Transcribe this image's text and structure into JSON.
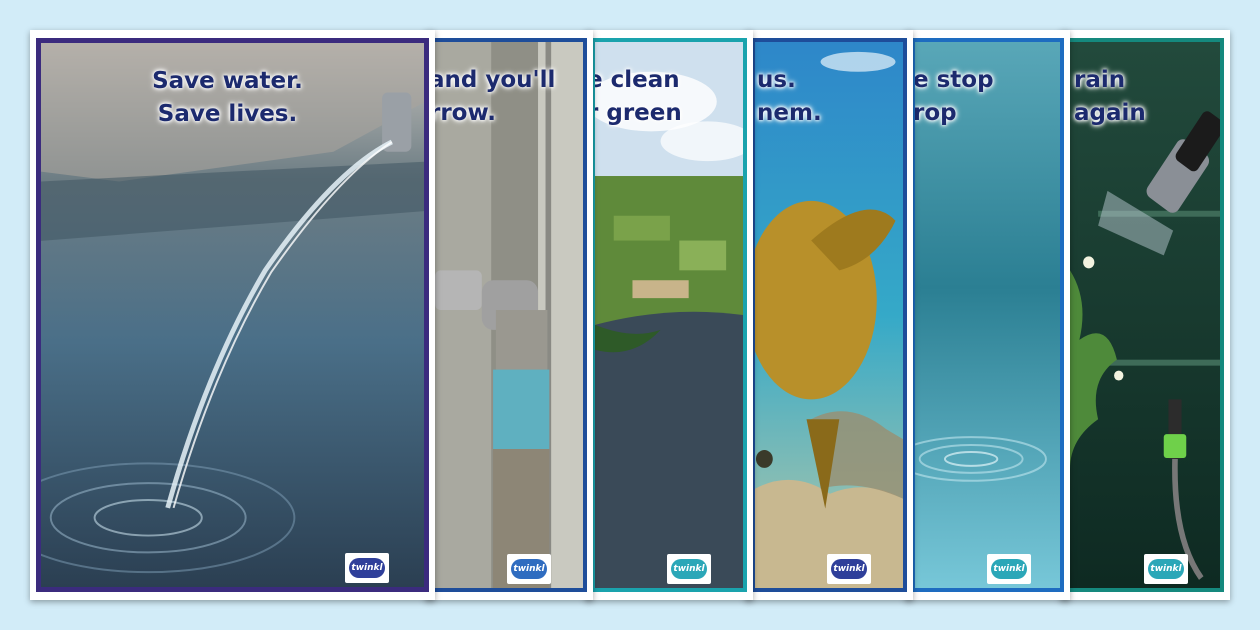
{
  "brand": "twinkl",
  "posters": [
    {
      "headline_lines": [
        "Save water.",
        "Save lives."
      ],
      "border_color": "#3b2b7e"
    },
    {
      "headline_lines": [
        "and you'll",
        "rrow."
      ],
      "border_color": "#1e4d9a"
    },
    {
      "headline_lines": [
        "e clean",
        "r green"
      ],
      "border_color": "#1aa3ad"
    },
    {
      "headline_lines": [
        "us.",
        "nem."
      ],
      "border_color": "#1e4d9a"
    },
    {
      "headline_lines": [
        "e stop",
        "rop"
      ],
      "border_color": "#1e6cc0"
    },
    {
      "headline_lines": [
        "rain",
        "again"
      ],
      "border_color": "#15897e"
    }
  ],
  "colors": {
    "headline_text": "#1c2a6e",
    "background": "#d2ecf8",
    "logo_cloud": "#2f3f9a"
  }
}
